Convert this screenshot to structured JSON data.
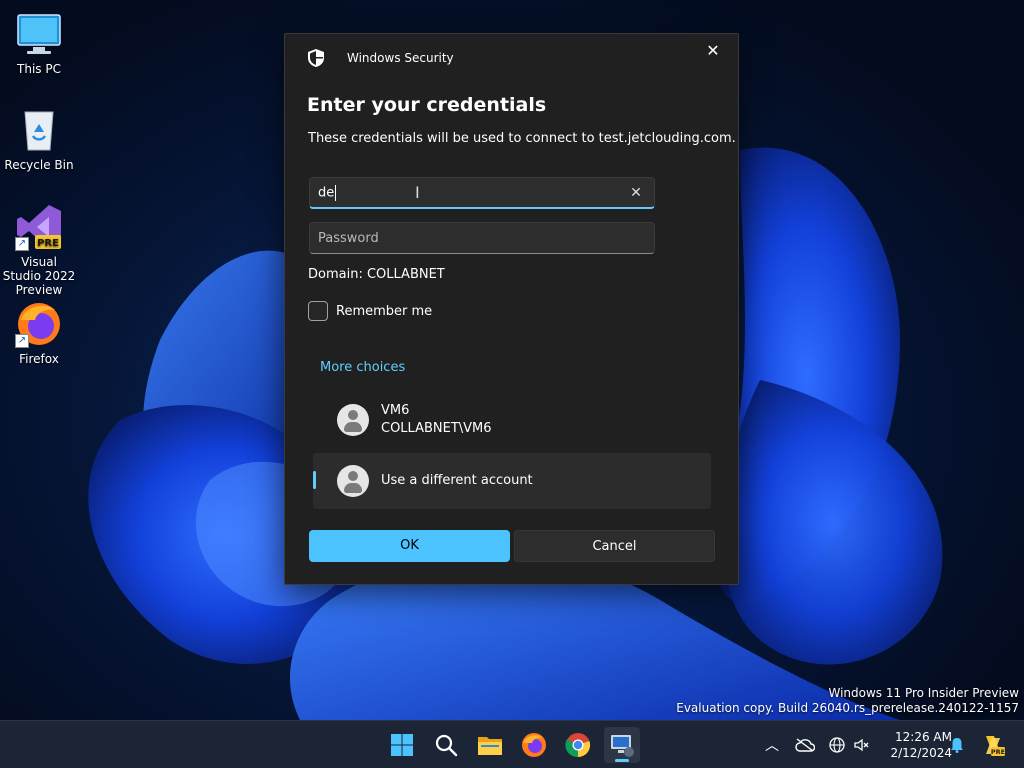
{
  "desktop": {
    "icons": [
      {
        "label": "This PC",
        "icon": "monitor-icon"
      },
      {
        "label": "Recycle Bin",
        "icon": "recycle-bin-icon"
      },
      {
        "label": "Visual Studio 2022 Preview",
        "icon": "visual-studio-icon",
        "badge": "PRE"
      },
      {
        "label": "Firefox",
        "icon": "firefox-icon"
      }
    ],
    "watermark": {
      "line1": "Windows 11 Pro Insider Preview",
      "line2": "Evaluation copy. Build 26040.rs_prerelease.240122-1157"
    }
  },
  "dialog": {
    "app_name": "Windows Security",
    "title": "Enter your credentials",
    "description": "These credentials will be used to connect to test.jetclouding.com.",
    "username_value": "de",
    "password_placeholder": "Password",
    "domain": "Domain: COLLABNET",
    "remember_label": "Remember me",
    "remember_checked": false,
    "more_choices": "More choices",
    "accounts": [
      {
        "name": "VM6",
        "detail": "COLLABNET\\VM6"
      },
      {
        "name": "Use a different account",
        "selected": true
      }
    ],
    "ok_label": "OK",
    "cancel_label": "Cancel",
    "accent_color": "#60cdff"
  },
  "taskbar": {
    "apps": [
      "start-icon",
      "search-icon",
      "file-explorer-icon",
      "firefox-icon",
      "chrome-icon",
      "remote-desktop-icon"
    ],
    "active_app": "remote-desktop-icon",
    "clock_time": "12:26 AM",
    "clock_date": "2/12/2024",
    "tray_badge": "PRE"
  }
}
